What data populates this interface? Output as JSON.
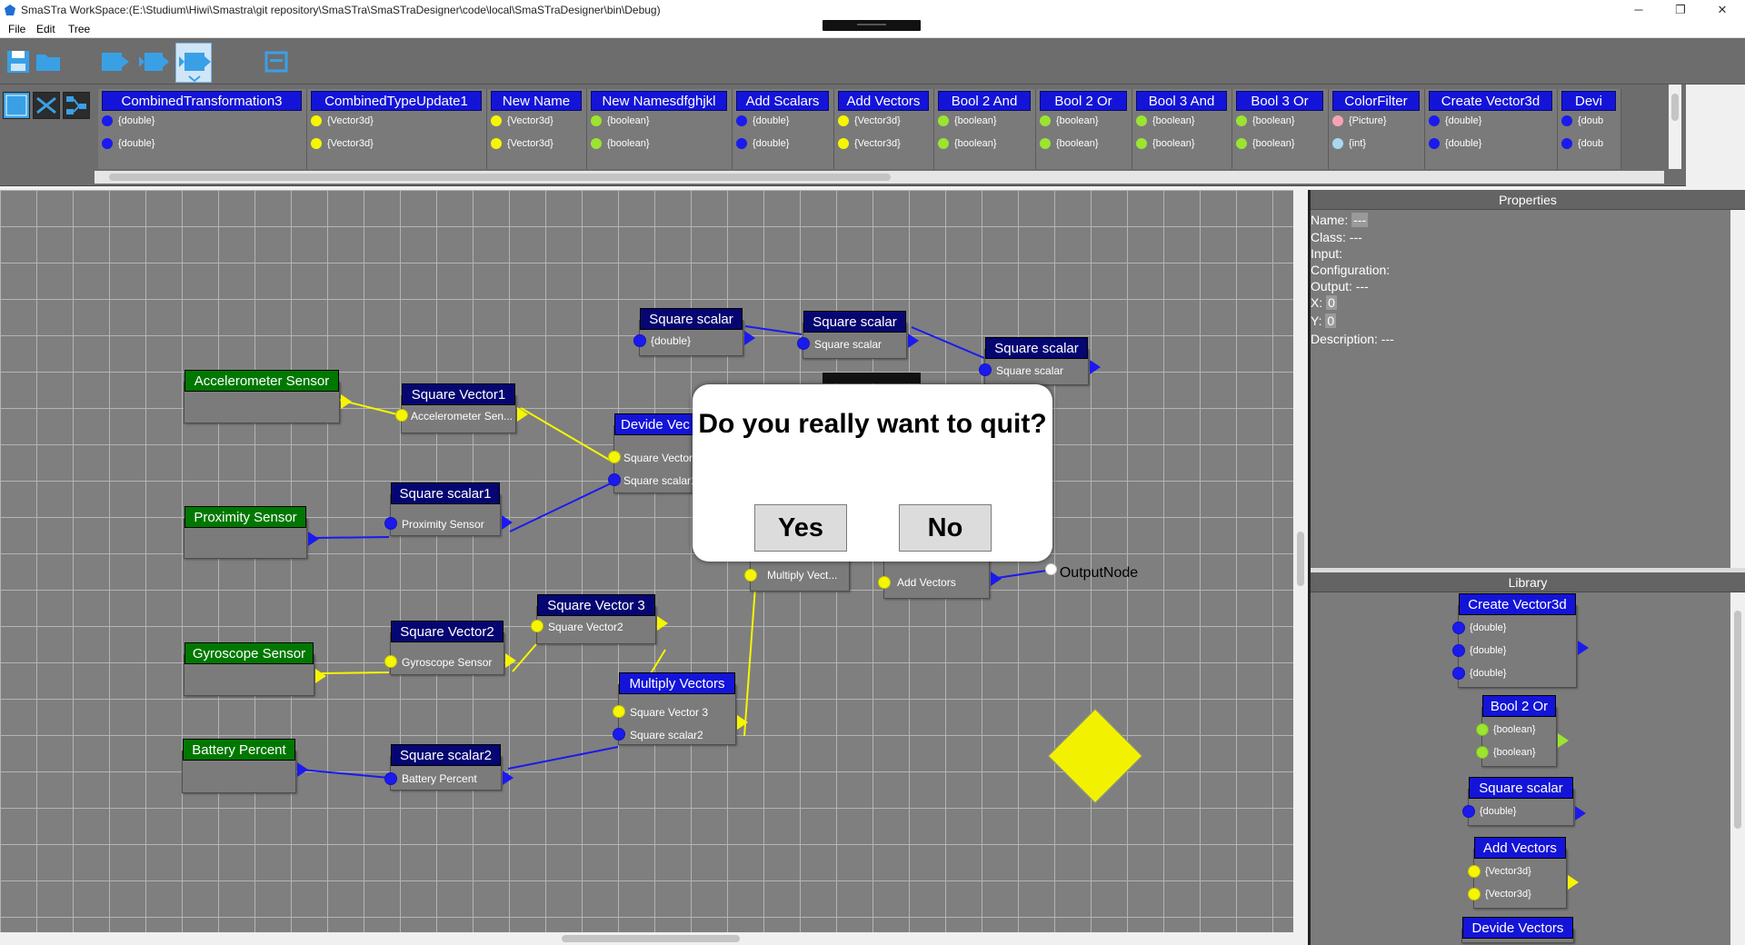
{
  "window": {
    "app_name": "SmaSTra",
    "title": "SmaSTra   WorkSpace:(E:\\Studium\\Hiwi\\Smastra\\git repository\\SmaSTra\\SmaSTraDesigner\\code\\local\\SmaSTraDesigner\\bin\\Debug)",
    "minimize": "─",
    "maximize": "❐",
    "close": "✕"
  },
  "menu": {
    "file": "File",
    "edit": "Edit",
    "tree": "Tree"
  },
  "palette": [
    {
      "name": "CombinedTransformation3",
      "ports": [
        "{double}",
        "{double}"
      ],
      "color": "#1a1aee"
    },
    {
      "name": "CombinedTypeUpdate1",
      "ports": [
        "{Vector3d}",
        "{Vector3d}"
      ],
      "color": "#f6f600"
    },
    {
      "name": "New Name",
      "ports": [
        "{Vector3d}",
        "{Vector3d}"
      ],
      "color": "#f6f600"
    },
    {
      "name": "New Namesdfghjkl",
      "ports": [
        "{boolean}",
        "{boolean}"
      ],
      "color": "#9be430"
    },
    {
      "name": "Add Scalars",
      "ports": [
        "{double}",
        "{double}"
      ],
      "color": "#1a1aee"
    },
    {
      "name": "Add Vectors",
      "ports": [
        "{Vector3d}",
        "{Vector3d}"
      ],
      "color": "#f6f600"
    },
    {
      "name": "Bool 2 And",
      "ports": [
        "{boolean}",
        "{boolean}"
      ],
      "color": "#9be430"
    },
    {
      "name": "Bool 2 Or",
      "ports": [
        "{boolean}",
        "{boolean}"
      ],
      "color": "#9be430"
    },
    {
      "name": "Bool 3 And",
      "ports": [
        "{boolean}",
        "{boolean}"
      ],
      "color": "#9be430"
    },
    {
      "name": "Bool 3 Or",
      "ports": [
        "{boolean}",
        "{boolean}"
      ],
      "color": "#9be430"
    },
    {
      "name": "ColorFilter",
      "ports": [
        "{Picture}",
        "{int}"
      ],
      "color": "#f7a3b3",
      "color2": "#a8d8f0"
    },
    {
      "name": "Create Vector3d",
      "ports": [
        "{double}",
        "{double}"
      ],
      "color": "#1a1aee"
    },
    {
      "name": "Devi",
      "ports": [
        "{doub",
        "{doub"
      ],
      "color": "#1a1aee"
    }
  ],
  "canvas": {
    "sensors": {
      "accelerometer": "Accelerometer Sensor",
      "proximity": "Proximity Sensor",
      "gyroscope": "Gyroscope Sensor",
      "battery": "Battery Percent"
    },
    "nodes": {
      "sq_vector1": {
        "title": "Square Vector1",
        "port": "Accelerometer Sen..."
      },
      "sq_scalar1": {
        "title": "Square scalar1",
        "port": "Proximity Sensor"
      },
      "sq_vector2": {
        "title": "Square Vector2",
        "port": "Gyroscope Sensor"
      },
      "sq_vector3": {
        "title": "Square Vector 3",
        "port": "Square Vector2"
      },
      "sq_scalar2": {
        "title": "Square scalar2",
        "port": "Battery Percent"
      },
      "mult_vectors": {
        "title": "Multiply Vectors",
        "port1": "Square Vector 3",
        "port2": "Square scalar2"
      },
      "devide": {
        "title": "Devide Vec",
        "port1": "Square Vector",
        "port2": "Square scalar1"
      },
      "sqs_a": {
        "title": "Square scalar",
        "port": "{double}"
      },
      "sqs_b": {
        "title": "Square scalar",
        "port": "Square scalar"
      },
      "sqs_c": {
        "title": "Square scalar",
        "port": "Square scalar"
      },
      "mult_partial": {
        "port": "Multiply Vect..."
      },
      "add_partial": {
        "port": "Add Vectors"
      }
    },
    "output_node": "OutputNode"
  },
  "dialog": {
    "question": "Do you really want to quit?",
    "yes": "Yes",
    "no": "No"
  },
  "properties": {
    "title": "Properties",
    "name_label": "Name:",
    "name_value": "---",
    "class_label": "Class: ---",
    "input_label": "Input:",
    "configuration_label": "Configuration:",
    "output_label": "Output: ---",
    "x_label": "X:",
    "x_value": "0",
    "y_label": "Y:",
    "y_value": "0",
    "description_label": "Description: ---"
  },
  "library": {
    "title": "Library",
    "items": [
      {
        "name": "Create Vector3d",
        "ports": [
          "{double}",
          "{double}",
          "{double}"
        ]
      },
      {
        "name": "Bool 2 Or",
        "ports": [
          "{boolean}",
          "{boolean}"
        ]
      },
      {
        "name": "Square scalar",
        "ports": [
          "{double}"
        ]
      },
      {
        "name": "Add Vectors",
        "ports": [
          "{Vector3d}",
          "{Vector3d}"
        ]
      },
      {
        "name": "Devide Vectors",
        "ports": []
      }
    ]
  },
  "colors": {
    "canvas_bg": "#7f7f7f",
    "grid": "#b4b4b4",
    "vector_wire": "#f6f600",
    "scalar_wire": "#1a1aee",
    "boolean_port": "#9be430",
    "sensor_header": "#007800",
    "node_header": "#060672"
  }
}
